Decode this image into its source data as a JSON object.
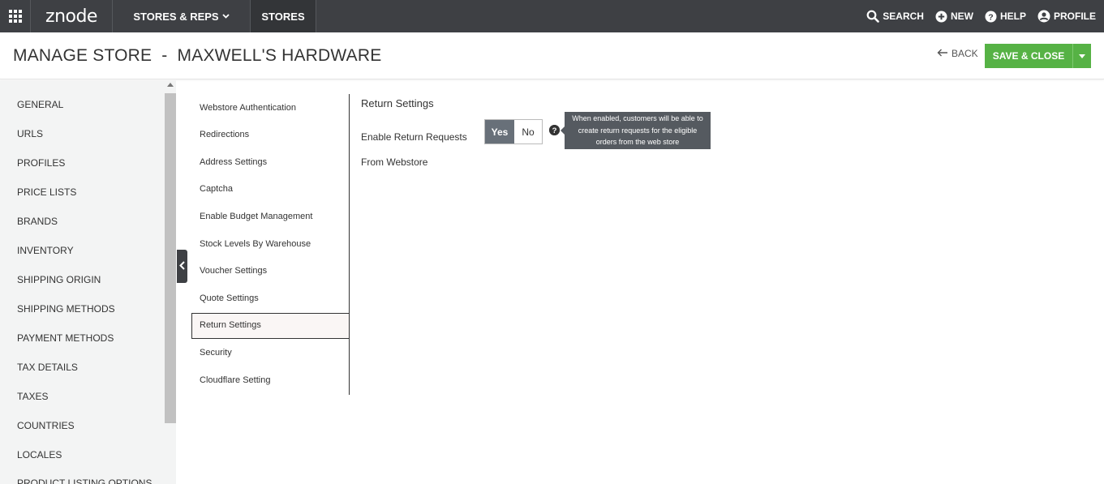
{
  "topbar": {
    "logo": "znode",
    "nav_stores_reps": "STORES & REPS",
    "nav_stores": "STORES",
    "actions": {
      "search": "SEARCH",
      "new": "NEW",
      "help": "HELP",
      "profile": "PROFILE"
    }
  },
  "header": {
    "title": "MANAGE STORE  -  MAXWELL'S HARDWARE",
    "back_label": "BACK",
    "save_close_label": "SAVE & CLOSE"
  },
  "sidebar": {
    "items": [
      "GENERAL",
      "URLS",
      "PROFILES",
      "PRICE LISTS",
      "BRANDS",
      "INVENTORY",
      "SHIPPING ORIGIN",
      "SHIPPING METHODS",
      "PAYMENT METHODS",
      "TAX DETAILS",
      "TAXES",
      "COUNTRIES",
      "LOCALES",
      "PRODUCT LISTING OPTIONS"
    ]
  },
  "subnav": {
    "items": [
      "Webstore Authentication",
      "Redirections",
      "Address Settings",
      "Captcha",
      "Enable Budget Management",
      "Stock Levels By Warehouse",
      "Voucher Settings",
      "Quote Settings",
      "Return Settings",
      "Security",
      "Cloudflare Setting"
    ],
    "active": "Return Settings"
  },
  "content": {
    "section_title": "Return Settings",
    "field_label": "Enable Return Requests From Webstore",
    "toggle_yes": "Yes",
    "toggle_no": "No",
    "toggle_value": "Yes",
    "tooltip": "When enabled, customers will be able to create return requests for the eligible orders from the web store"
  },
  "colors": {
    "topbar": "#3e4044",
    "accent_green": "#56b245",
    "toggle_active": "#687079"
  }
}
